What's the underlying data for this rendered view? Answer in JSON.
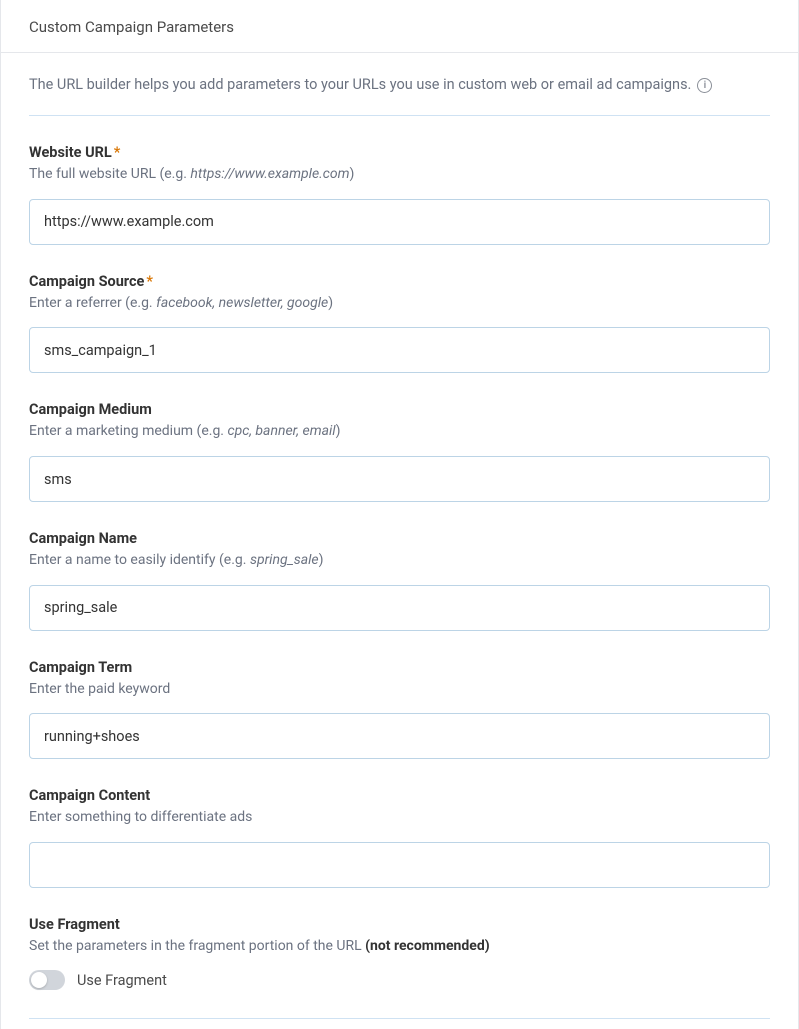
{
  "header": {
    "title": "Custom Campaign Parameters"
  },
  "intro": {
    "text": "The URL builder helps you add parameters to your URLs you use in custom web or email ad campaigns."
  },
  "fields": {
    "website_url": {
      "label": "Website URL",
      "required_mark": "*",
      "hint_pre": "The full website URL (e.g. ",
      "hint_em": "https://www.example.com",
      "hint_post": ")",
      "value": "https://www.example.com"
    },
    "campaign_source": {
      "label": "Campaign Source",
      "required_mark": "*",
      "hint_pre": "Enter a referrer (e.g. ",
      "hint_em": "facebook, newsletter, google",
      "hint_post": ")",
      "value": "sms_campaign_1"
    },
    "campaign_medium": {
      "label": "Campaign Medium",
      "hint_pre": "Enter a marketing medium (e.g. ",
      "hint_em": "cpc, banner, email",
      "hint_post": ")",
      "value": "sms"
    },
    "campaign_name": {
      "label": "Campaign Name",
      "hint_pre": "Enter a name to easily identify (e.g. ",
      "hint_em": "spring_sale",
      "hint_post": ")",
      "value": "spring_sale"
    },
    "campaign_term": {
      "label": "Campaign Term",
      "hint_plain": "Enter the paid keyword",
      "value": "running+shoes"
    },
    "campaign_content": {
      "label": "Campaign Content",
      "hint_plain": "Enter something to differentiate ads",
      "value": ""
    },
    "use_fragment": {
      "label": "Use Fragment",
      "hint_pre": "Set the parameters in the fragment portion of the URL ",
      "hint_strong": "(not recommended)",
      "toggle_label": "Use Fragment",
      "checked": false
    }
  }
}
